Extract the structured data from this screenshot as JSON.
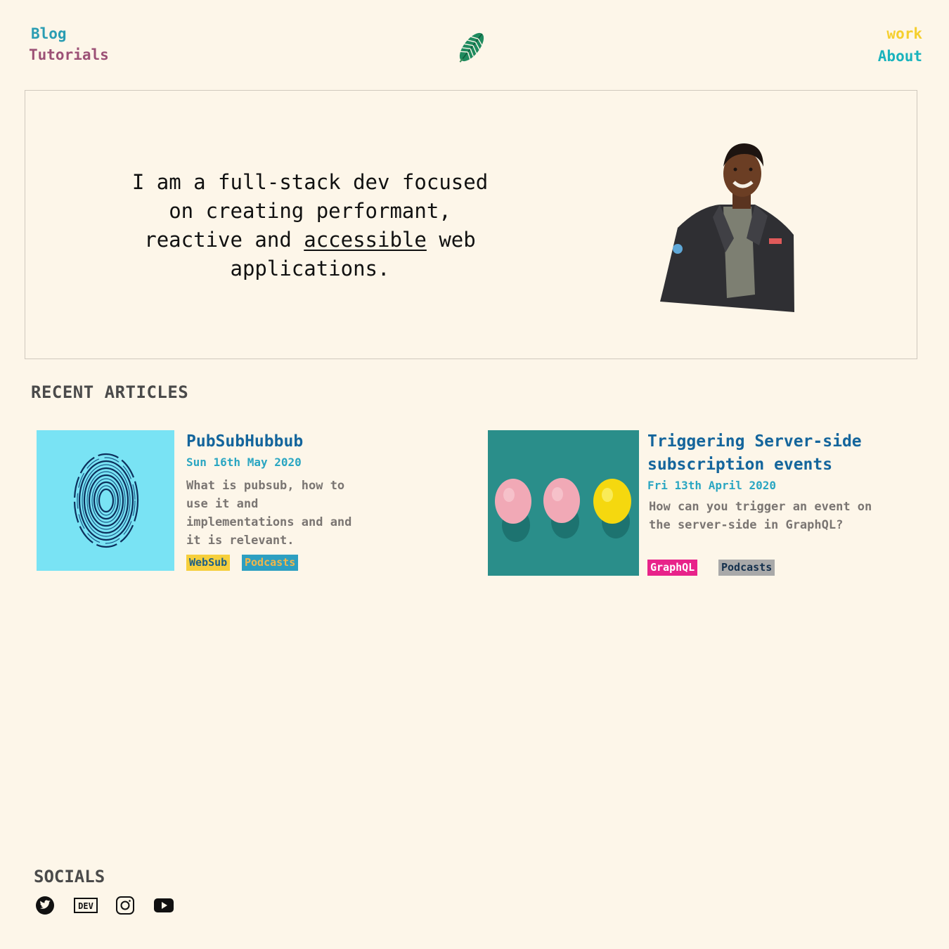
{
  "nav": {
    "blog": "Blog",
    "tutorials": "Tutorials",
    "work": "work",
    "about": "About"
  },
  "logo": {
    "icon": "leaf-icon"
  },
  "hero": {
    "text_before": "I am a full-stack dev focused on creating performant, reactive and",
    "text_link": "accessible",
    "text_after": "web applications.",
    "portrait_icon": "portrait-photo"
  },
  "recent": {
    "heading": "RECENT ARTICLES",
    "articles": [
      {
        "title": "PubSubHubbub",
        "date": "Sun 16th May 2020",
        "excerpt": "What is pubsub, how to use it and implementations and and it is relevant.",
        "thumbnail": "fingerprint-image",
        "tags": [
          {
            "label": "WebSub",
            "bg": "#f6cf3c",
            "fg": "#1d5f86"
          },
          {
            "label": "Podcasts",
            "bg": "#2d9fc1",
            "fg": "#f2b64a"
          }
        ]
      },
      {
        "title": "Triggering Server-side subscription events",
        "date": "Fri 13th April 2020",
        "excerpt": "How can you trigger an event on the server-side in GraphQL?",
        "thumbnail": "lemons-image",
        "tags": [
          {
            "label": "GraphQL",
            "bg": "#e8238a",
            "fg": "#ffffff"
          },
          {
            "label": "Podcasts",
            "bg": "#a9a9a9",
            "fg": "#14304d"
          }
        ]
      }
    ]
  },
  "socials": {
    "heading": "SOCIALS",
    "icons": [
      "twitter-icon",
      "dev-icon",
      "instagram-icon",
      "youtube-icon"
    ],
    "dev_label": "DEV"
  },
  "colors": {
    "background": "#fdf6e9",
    "title_blue": "#14659c",
    "date_blue": "#2aa6c2"
  }
}
